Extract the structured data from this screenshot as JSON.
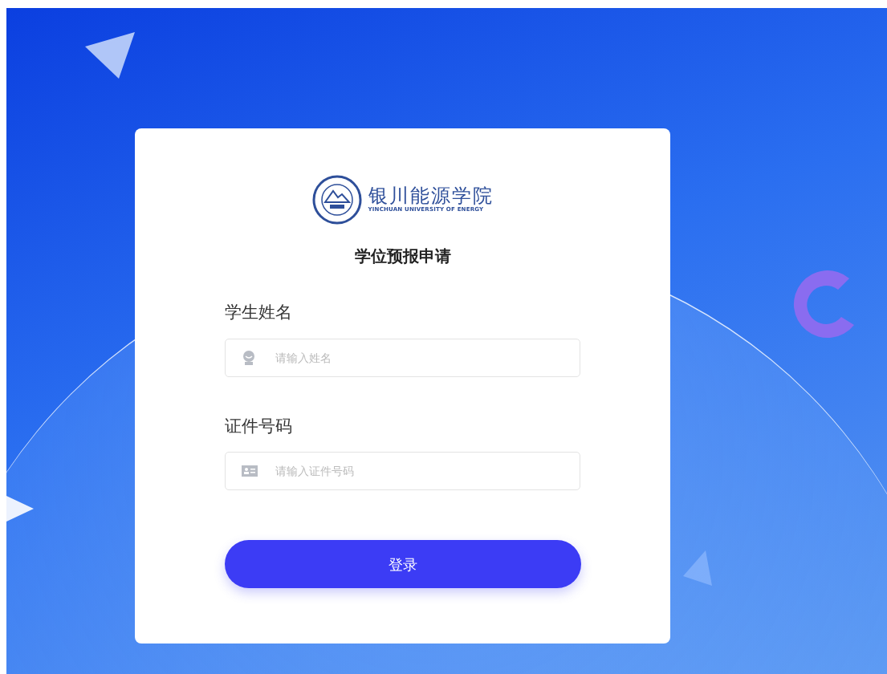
{
  "logo": {
    "name": "银川能源学院",
    "subtitle": "YINCHUAN UNIVERSITY OF ENERGY"
  },
  "title": "学位预报申请",
  "fields": [
    {
      "kind": "person",
      "label": "学生姓名",
      "placeholder": "请输入姓名"
    },
    {
      "kind": "id-card",
      "label": "证件号码",
      "placeholder": "请输入证件号码"
    }
  ],
  "login_button": "登录"
}
